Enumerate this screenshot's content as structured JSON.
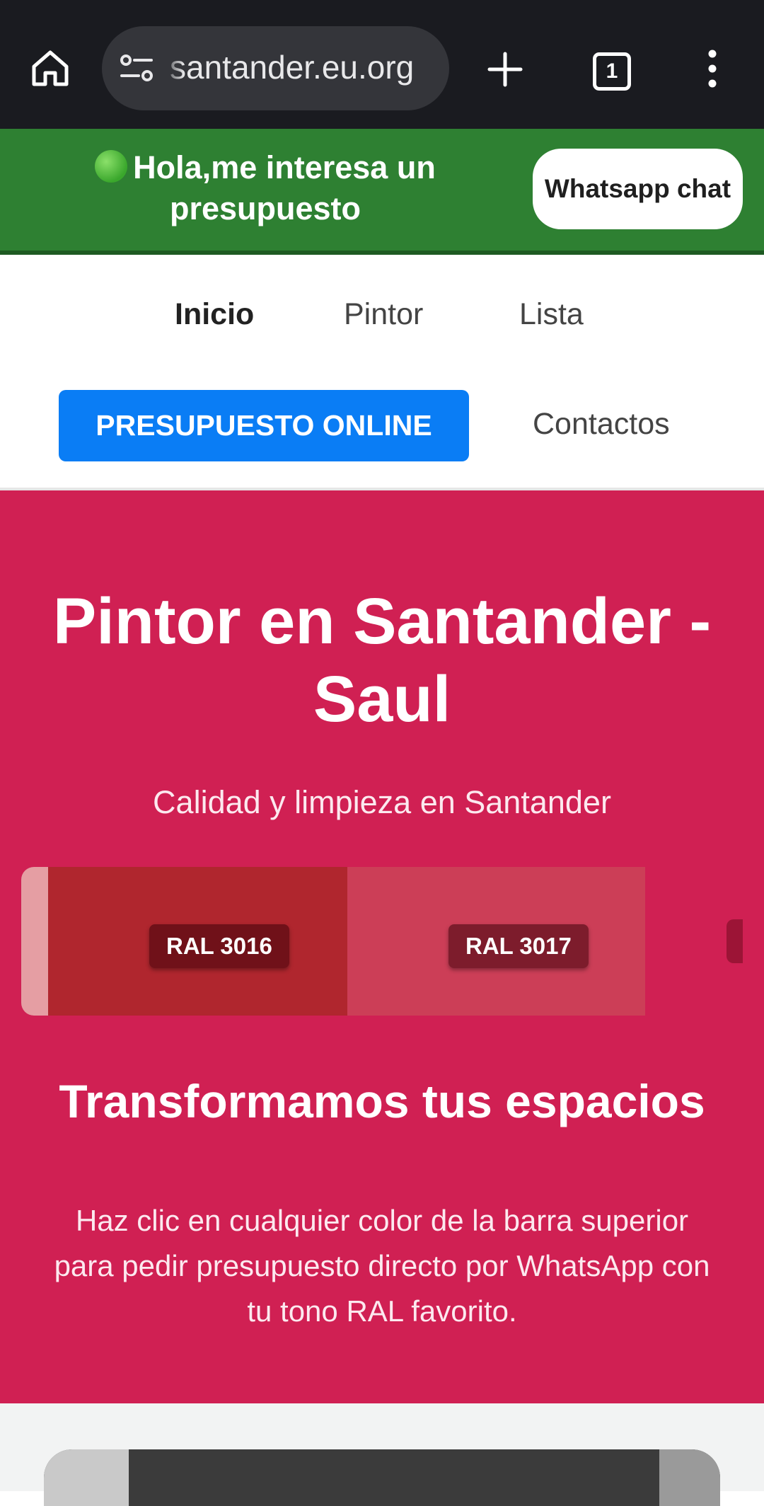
{
  "browser": {
    "url": "santander.eu.org",
    "tab_count": "1"
  },
  "banner": {
    "message": "Hola,me interesa un presupuesto",
    "whatsapp_button": "Whatsapp chat"
  },
  "nav": {
    "items": [
      {
        "label": "Inicio",
        "active": true
      },
      {
        "label": "Pintor"
      },
      {
        "label": "Lista"
      }
    ],
    "cta_label": "PRESUPUESTO ONLINE",
    "contacts_label": "Contactos"
  },
  "hero": {
    "title": "Pintor en Santander - Saul",
    "subtitle": "Calidad y limpieza en Santander",
    "swatches": [
      {
        "label": "RAL 3016",
        "color": "#b0262e"
      },
      {
        "label": "RAL 3017",
        "color": "#cc3e57"
      }
    ],
    "heading": "Transformamos tus espacios",
    "description": "Haz clic en cualquier color de la barra superior para pedir presupuesto directo por WhatsApp con tu tono RAL favorito."
  },
  "colors": {
    "chrome": "#1a1b20",
    "banner_green": "#2e8032",
    "cta_blue": "#0a7df5",
    "hero_bg": "#d02053"
  }
}
